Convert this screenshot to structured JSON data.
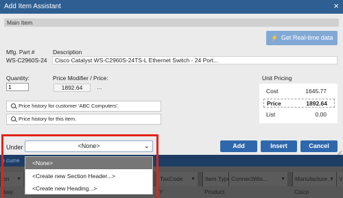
{
  "window": {
    "title": "Add Item Assistant",
    "close_glyph": "×"
  },
  "section": {
    "title": "Main Item"
  },
  "realtime_button": {
    "label": "Get Real-time data",
    "icon": "bolt-icon"
  },
  "item": {
    "mfg_part_label": "Mfg. Part #",
    "mfg_part_value": "WS-C2960S-24",
    "description_label": "Description",
    "description_value": "Cisco Catalyst WS-C2960S-24TS-L Ethernet Switch - 24 Port..."
  },
  "quantity": {
    "label": "Quantity:",
    "value": "1"
  },
  "price_modifier": {
    "label": "Price Modifier / Price:",
    "value": "1892.64",
    "more": "..."
  },
  "history": {
    "customer_label": "Price history for customer 'ABC Computers'.",
    "item_label": "Price history for this item."
  },
  "unit_pricing": {
    "title": "Unit Pricing",
    "rows": [
      {
        "label": "Cost",
        "value": "1645.77"
      },
      {
        "label": "Price",
        "value": "1892.64"
      },
      {
        "label": "List",
        "value": "0.00"
      }
    ]
  },
  "under": {
    "label": "Under",
    "selected": "<None>",
    "options": [
      "<None>",
      "<Create new Section Header...>",
      "<Create new Heading...>"
    ]
  },
  "actions": {
    "add": "Add",
    "insert": "Insert",
    "cancel": "Cancel"
  },
  "background_grid": {
    "strip_text": "o curre",
    "columns": [
      {
        "label": "on",
        "dropdown": "▼"
      },
      {
        "label": "TaxCode",
        "dropdown": "▼"
      },
      {
        "label": "Item Type",
        "dropdown": "▼"
      },
      {
        "label": "ConnectWis...",
        "dropdown": "▼"
      },
      {
        "label": "Manufacture...",
        "dropdown": "▼"
      },
      {
        "label": "V",
        "dropdown": ""
      }
    ],
    "row": {
      "c0": "itaiy",
      "c1": "Y",
      "c2": "Product",
      "c3": "",
      "c4": "Cisco"
    }
  },
  "colors": {
    "titlebar": "#2f5f92",
    "primary_button": "#2f67ad",
    "highlight_box": "#e2231a",
    "selected_option": "#767676"
  }
}
